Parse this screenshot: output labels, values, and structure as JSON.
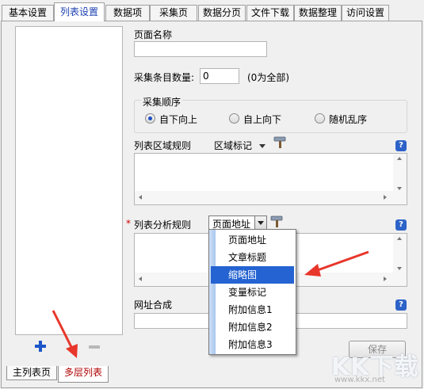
{
  "tabs": [
    {
      "label": "基本设置",
      "active": false
    },
    {
      "label": "列表设置",
      "active": true
    },
    {
      "label": "数据项",
      "active": false
    },
    {
      "label": "采集页",
      "active": false
    },
    {
      "label": "数据分页",
      "active": false
    },
    {
      "label": "文件下载",
      "active": false
    },
    {
      "label": "数据整理",
      "active": false
    },
    {
      "label": "访问设置",
      "active": false
    }
  ],
  "form": {
    "page_name_label": "页面名称",
    "page_name_value": "",
    "collect_count_label": "采集条目数量:",
    "collect_count_value": "0",
    "collect_count_hint": "(0为全部)",
    "order_group_label": "采集顺序",
    "order_options": [
      "自下向上",
      "自上向下",
      "随机乱序"
    ],
    "order_selected": "自下向上",
    "list_region_label": "列表区域规则",
    "region_mark_label": "区域标记",
    "list_parse_label": "列表分析规则",
    "required_mark": "*",
    "parse_select_value": "页面地址",
    "url_compose_label": "网址合成",
    "help_glyph": "?",
    "save_label": "保存"
  },
  "dropdown_options": [
    "页面地址",
    "文章标题",
    "缩略图",
    "变量标记",
    "附加信息1",
    "附加信息2",
    "附加信息3"
  ],
  "dropdown_selected": "缩略图",
  "bottom_tabs": [
    {
      "label": "主列表页",
      "active": false
    },
    {
      "label": "多层列表",
      "active": true
    }
  ],
  "watermark": {
    "text": "KK下载",
    "url": "www.kkx.net"
  },
  "colors": {
    "accent": "#2463d1",
    "annotation_arrow": "#e8362b",
    "active_tab_text": "#1a3fb0"
  }
}
